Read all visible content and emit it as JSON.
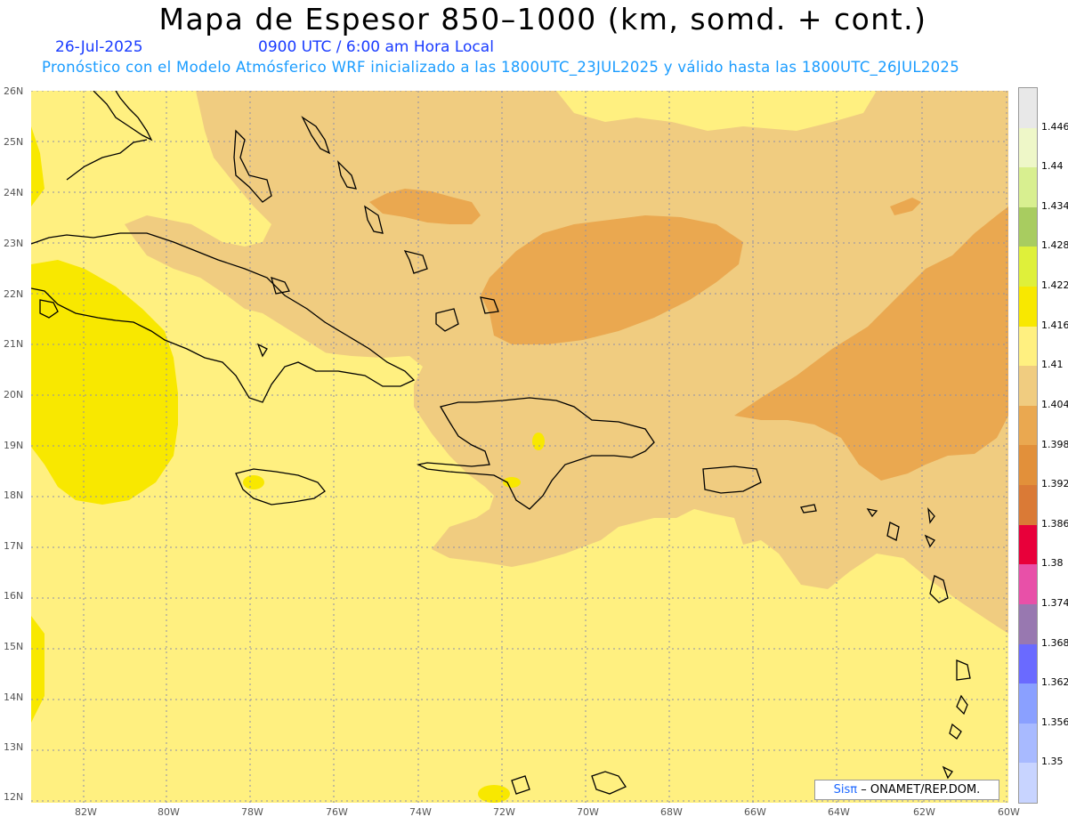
{
  "title": "Mapa de Espesor 850–1000 (km, somd. + cont.)",
  "date": "26-Jul-2025",
  "time": "0900 UTC / 6:00 am Hora Local",
  "forecast_line": "Pronóstico con el Modelo Atmósferico WRF inicializado a las 1800UTC_23JUL2025 y válido hasta las  1800UTC_26JUL2025",
  "lat_labels": [
    "26N",
    "25N",
    "24N",
    "23N",
    "22N",
    "21N",
    "20N",
    "19N",
    "18N",
    "17N",
    "16N",
    "15N",
    "14N",
    "13N",
    "12N"
  ],
  "lon_labels": [
    "82W",
    "80W",
    "78W",
    "76W",
    "74W",
    "72W",
    "70W",
    "68W",
    "66W",
    "64W",
    "62W",
    "60W"
  ],
  "colorbar": {
    "labels": [
      "1.446",
      "1.44",
      "1.434",
      "1.428",
      "1.422",
      "1.416",
      "1.41",
      "1.404",
      "1.398",
      "1.392",
      "1.386",
      "1.38",
      "1.374",
      "1.368",
      "1.362",
      "1.356",
      "1.35"
    ],
    "colors": [
      "#e8e8e8",
      "#eef7c8",
      "#d8ef90",
      "#a8cc60",
      "#dff03a",
      "#f8e800",
      "#fff080",
      "#f0cc80",
      "#eaa850",
      "#e2903a",
      "#da7a36",
      "#e8003a",
      "#e850a8",
      "#9878b0",
      "#6a6aff",
      "#8aa0ff",
      "#a8baff",
      "#c8d4ff"
    ]
  },
  "map_colors": {
    "t1404": "#f0cc80",
    "t1398": "#eaa850",
    "t1410": "#fff080",
    "t1416": "#f8e800",
    "grid": "#8e8ea8",
    "coast": "#000000"
  },
  "credit": {
    "brand": "Sisπ",
    "text": "– ONAMET/REP.DOM."
  }
}
